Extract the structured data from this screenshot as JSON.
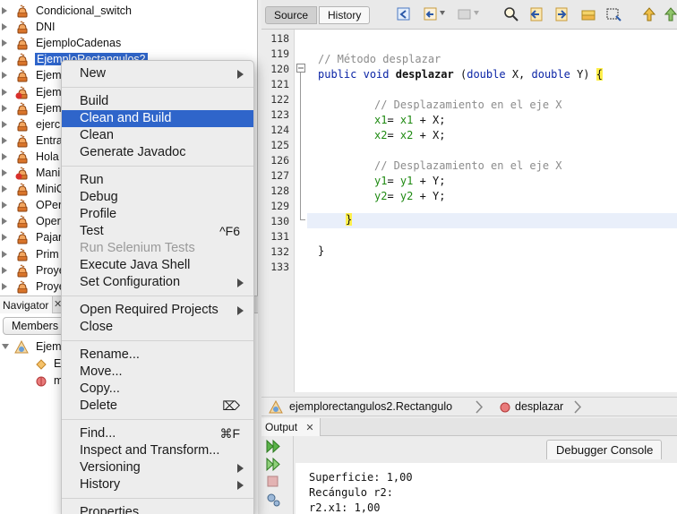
{
  "project_tree": {
    "items": [
      {
        "label": "Condicional_switch",
        "selected": false
      },
      {
        "label": "DNI",
        "selected": false
      },
      {
        "label": "EjemploCadenas",
        "selected": false
      },
      {
        "label": "EjemploRectangulos2",
        "selected": true
      },
      {
        "label": "Ejemp",
        "selected": false
      },
      {
        "label": "Ejemp",
        "selected": false
      },
      {
        "label": "Ejemp",
        "selected": false
      },
      {
        "label": "ejerc",
        "selected": false
      },
      {
        "label": "Entra",
        "selected": false
      },
      {
        "label": "Hola",
        "selected": false
      },
      {
        "label": "Mani",
        "selected": false
      },
      {
        "label": "MiniC",
        "selected": false
      },
      {
        "label": "OPer",
        "selected": false
      },
      {
        "label": "Oper",
        "selected": false
      },
      {
        "label": "Pajar",
        "selected": false
      },
      {
        "label": "Prim",
        "selected": false
      },
      {
        "label": "Proye",
        "selected": false
      },
      {
        "label": "Proye",
        "selected": false
      }
    ]
  },
  "navigator": {
    "tab_label": "Navigator",
    "close_glyph": "✕",
    "members_select": "Members",
    "rows": [
      {
        "label": "Ejem",
        "icon": "class-icon"
      },
      {
        "label": "Ej",
        "icon": "field-icon"
      },
      {
        "label": "ma",
        "icon": "method-icon"
      }
    ]
  },
  "editor": {
    "tabs": {
      "source": "Source",
      "history": "History"
    },
    "lines": [
      {
        "num": "118"
      },
      {
        "num": "119"
      },
      {
        "num": "120"
      },
      {
        "num": "121"
      },
      {
        "num": "122"
      },
      {
        "num": "123"
      },
      {
        "num": "124"
      },
      {
        "num": "125"
      },
      {
        "num": "126"
      },
      {
        "num": "127"
      },
      {
        "num": "128"
      },
      {
        "num": "129"
      },
      {
        "num": "130"
      },
      {
        "num": "131"
      },
      {
        "num": "132"
      },
      {
        "num": "133"
      }
    ],
    "code": {
      "l119": "// Método desplazar",
      "l120_kw1": "public",
      "l120_kw2": "void",
      "l120_name": "desplazar",
      "l120_p1": "(",
      "l120_t1": "double",
      "l120_p2": " X, ",
      "l120_t2": "double",
      "l120_p3": " Y) ",
      "l120_brace": "{",
      "l122": "// Desplazamiento en el eje X",
      "l123_f1": "x1",
      "l123_eq": "= ",
      "l123_f2": "x1",
      "l123_rest": " + X;",
      "l124_f1": "x2",
      "l124_eq": "= ",
      "l124_f2": "x2",
      "l124_rest": " + X;",
      "l126": "// Desplazamiento en el eje X",
      "l127_f1": "y1",
      "l127_eq": "= ",
      "l127_f2": "y1",
      "l127_rest": " + Y;",
      "l128_f1": "y2",
      "l128_eq": "= ",
      "l128_f2": "y2",
      "l128_rest": " + Y;",
      "l130": "}",
      "l132": "}"
    }
  },
  "breadcrumb": {
    "class_path": "ejemplorectangulos2.Rectangulo",
    "method": "desplazar"
  },
  "output": {
    "tab_label": "Output",
    "close_glyph": "✕",
    "debugger_tab": "Debugger Console",
    "lines": [
      "Superficie: 1,00",
      "Recángulo r2:",
      "r2.x1: 1,00"
    ]
  },
  "context_menu": {
    "items": [
      {
        "label": "New",
        "submenu": true
      },
      {
        "label": "Build"
      },
      {
        "label": "Clean and Build",
        "highlight": true
      },
      {
        "label": "Clean"
      },
      {
        "label": "Generate Javadoc"
      },
      {
        "label": "Run"
      },
      {
        "label": "Debug"
      },
      {
        "label": "Profile"
      },
      {
        "label": "Test",
        "shortcut": "^F6"
      },
      {
        "label": "Run Selenium Tests",
        "disabled": true
      },
      {
        "label": "Execute Java Shell"
      },
      {
        "label": "Set Configuration",
        "submenu": true
      },
      {
        "label": "Open Required Projects",
        "submenu": true
      },
      {
        "label": "Close"
      },
      {
        "label": "Rename..."
      },
      {
        "label": "Move..."
      },
      {
        "label": "Copy..."
      },
      {
        "label": "Delete",
        "shortcut": "⌦"
      },
      {
        "label": "Find...",
        "shortcut": "⌘F"
      },
      {
        "label": "Inspect and Transform..."
      },
      {
        "label": "Versioning",
        "submenu": true
      },
      {
        "label": "History",
        "submenu": true
      },
      {
        "label": "Properties"
      }
    ]
  },
  "colors": {
    "selection": "#2f65ca",
    "keyword": "#0b24a6",
    "comment": "#8c8c8c",
    "field": "#1f8a12",
    "brace_highlight": "#ffef4a"
  }
}
